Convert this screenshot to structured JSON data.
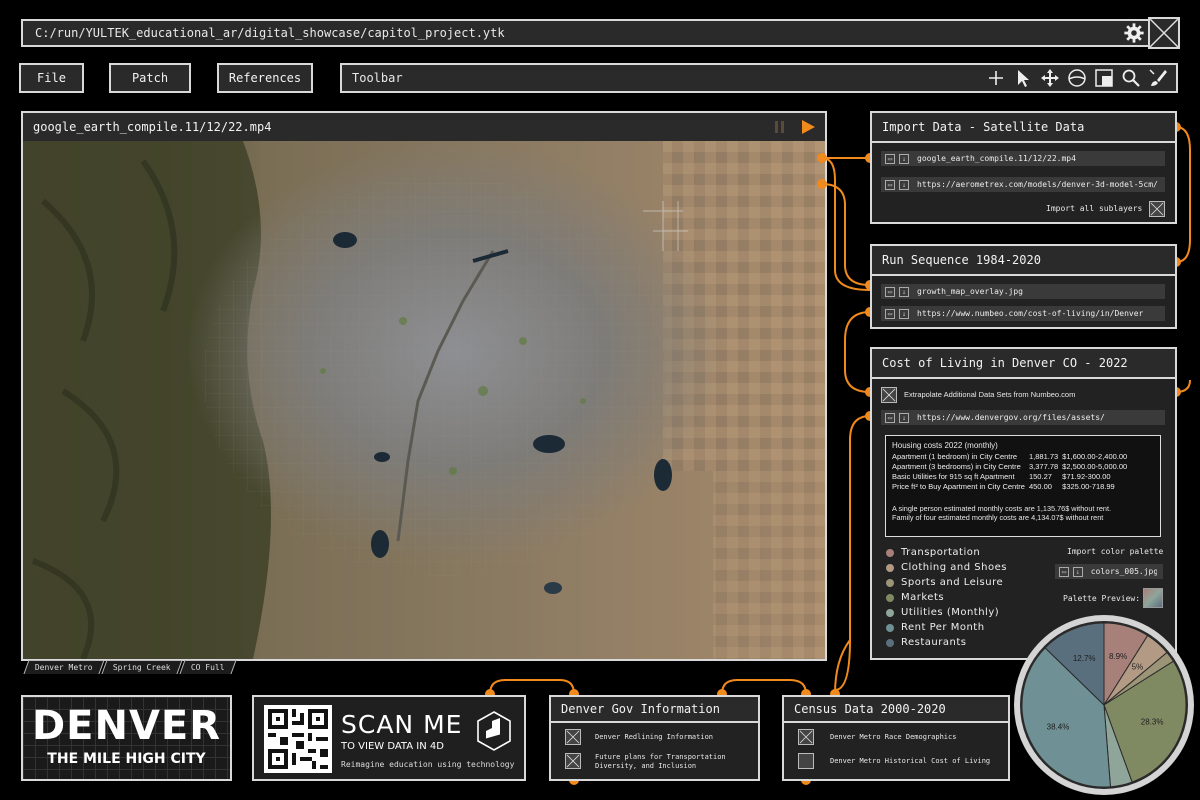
{
  "path_bar": {
    "text": "C:/run/YULTEK_educational_ar/digital_showcase/capitol_project.ytk"
  },
  "menu": {
    "file": "File",
    "patch": "Patch",
    "references": "References"
  },
  "toolbar": {
    "label": "Toolbar"
  },
  "video": {
    "title": "google_earth_compile.11/12/22.mp4",
    "tabs": [
      "Denver Metro",
      "Spring Creek",
      "CO Full"
    ]
  },
  "import_panel": {
    "title": "Import Data - Satellite Data",
    "files": [
      "google_earth_compile.11/12/22.mp4",
      "https://aerometrex.com/models/denver-3d-model-5cm/"
    ],
    "sublayers_label": "Import all sublayers"
  },
  "run_panel": {
    "title": "Run Sequence 1984-2020",
    "files": [
      "growth_map_overlay.jpg",
      "https://www.numbeo.com/cost-of-living/in/Denver"
    ]
  },
  "cost_panel": {
    "title": "Cost of Living in Denver CO - 2022",
    "extrapolate_label": "Extrapolate Additional Data Sets from Numbeo.com",
    "url": "https://www.denvergov.org/files/assets/",
    "housing_title": "Housing costs 2022 (monthly)",
    "housing_rows": [
      [
        "Apartment (1 bedroom) in City Centre",
        "1,881.73",
        "$1,600.00-2,400.00"
      ],
      [
        "Apartment (3 bedrooms) in City Centre",
        "3,377.78",
        "$2,500.00-5,000.00"
      ],
      [
        "Basic Utilities for 915 sq ft Apartment",
        "150.27",
        "$71.92-300.00"
      ],
      [
        "Price ft² to Buy Apartment in City Centre",
        "450.00",
        "$325.00-718.99"
      ]
    ],
    "note_single": "A single person estimated monthly costs are 1,135.76$ without rent.",
    "note_family": "Family of four estimated monthly costs are 4,134.07$ without rent",
    "legend": [
      {
        "label": "Transportation",
        "color": "#a8807a"
      },
      {
        "label": "Clothing and Shoes",
        "color": "#b29a84"
      },
      {
        "label": "Sports and Leisure",
        "color": "#9c9476"
      },
      {
        "label": "Markets",
        "color": "#7f8a62"
      },
      {
        "label": "Utilities (Monthly)",
        "color": "#8fa59a"
      },
      {
        "label": "Rent Per Month",
        "color": "#6f9094"
      },
      {
        "label": "Restaurants",
        "color": "#5a6f7e"
      }
    ],
    "import_palette_label": "Import color palette",
    "palette_file": "colors_005.jpg",
    "palette_preview_label": "Palette Preview:"
  },
  "chart_data": {
    "type": "pie",
    "slices": [
      {
        "label": "8.9%",
        "value": 8.9,
        "color": "#a8807a"
      },
      {
        "label": "5%",
        "value": 5,
        "color": "#b29a84"
      },
      {
        "label": "",
        "value": 2.1,
        "color": "#9c9476"
      },
      {
        "label": "28.3%",
        "value": 28.3,
        "color": "#7f8a62"
      },
      {
        "label": "",
        "value": 4.3,
        "color": "#8fa59a"
      },
      {
        "label": "38.4%",
        "value": 38.4,
        "color": "#6f9094"
      },
      {
        "label": "12.7%",
        "value": 12.7,
        "color": "#5a6f7e"
      }
    ]
  },
  "denver_logo": {
    "title": "DENVER",
    "subtitle": "THE MILE HIGH CITY"
  },
  "scan": {
    "title": "SCAN ME",
    "subtitle": "TO VIEW DATA IN 4D",
    "tagline": "Reimagine education using technology"
  },
  "gov_panel": {
    "title": "Denver Gov Information",
    "items": [
      "Denver Redlining Information",
      "Future plans for Transportation",
      "Diversity, and Inclusion"
    ]
  },
  "census_panel": {
    "title": "Census Data 2000-2020",
    "items": [
      "Denver Metro Race Demographics",
      "Denver Metro Historical Cost of Living"
    ]
  }
}
